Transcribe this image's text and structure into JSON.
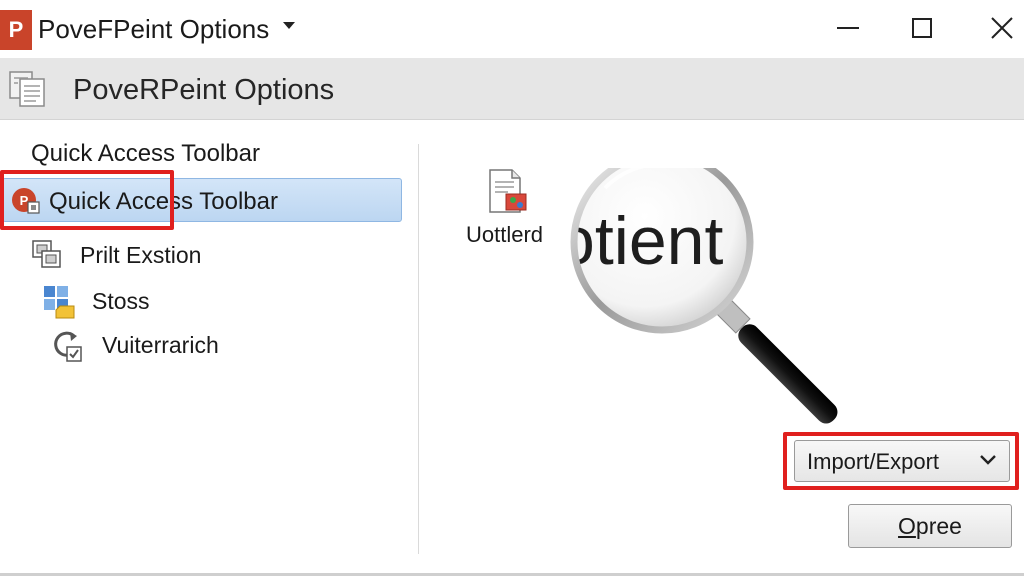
{
  "titlebar": {
    "app_icon_letter": "P",
    "title": "PoveFPeint Options",
    "controls": [
      "minimize-icon",
      "maximize-icon",
      "close-icon"
    ]
  },
  "header": {
    "icon": "options-document-icon",
    "title": "PoveRPeint Options"
  },
  "left_pane": {
    "section_title": "Quick Access Toolbar",
    "selected_item": {
      "label": "Quick Access Toolbar",
      "icon": "powerpoint-icon"
    },
    "items": [
      {
        "label": "Prilt Exstion",
        "icon": "print-windows-icon"
      },
      {
        "label": "Stoss",
        "icon": "grid-folder-icon"
      },
      {
        "label": "Vuiterrarich",
        "icon": "refresh-check-icon"
      }
    ]
  },
  "right_pane": {
    "doc_icon": "document-image-icon",
    "doc_label": "Uottlerd",
    "magnifier_text": "otient",
    "import_export_label": "Import/Export",
    "opree_first_letter": "O",
    "opree_rest": "pree"
  },
  "colors": {
    "highlight_red": "#e0201e",
    "selection_blue": "#bcd6f1",
    "header_gray": "#e6e6e6",
    "app_orange": "#c9442a"
  }
}
